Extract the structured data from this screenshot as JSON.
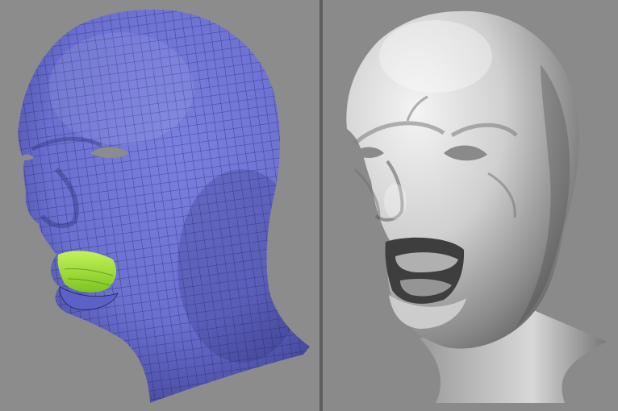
{
  "scene": {
    "background_left": "#8c8c8c",
    "background_right": "#8a8a8a",
    "divider_color": "#5e5e5e"
  },
  "wireframe_view": {
    "mesh_color": "#6a6fd0",
    "mesh_shadow": "#3c3f8e",
    "grid_line_color": "#1c1f5a",
    "mouth_color": "#9ee035"
  },
  "shaded_view": {
    "surface_light": "#f4f4f4",
    "surface_mid": "#b8b8b8",
    "surface_dark": "#5a5a5a"
  }
}
